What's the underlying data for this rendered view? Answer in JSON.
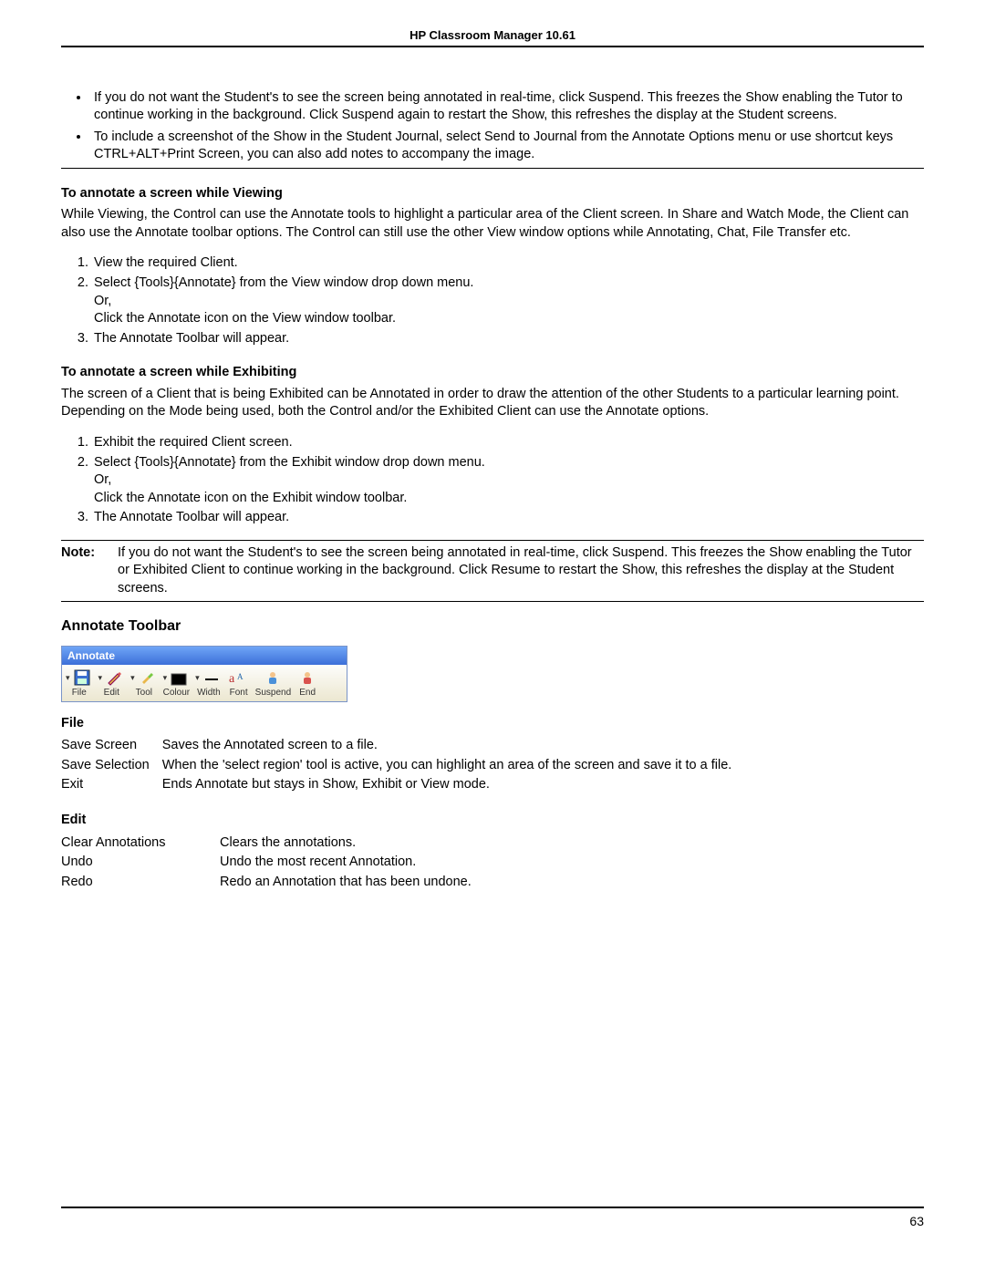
{
  "header": {
    "title": "HP Classroom Manager 10.61"
  },
  "bullets_top": [
    "If you do not want the Student's to see the screen being annotated in real-time, click Suspend. This freezes the Show enabling the Tutor to continue working in the background. Click Suspend again to restart the Show, this refreshes the display at the Student screens.",
    "To include a screenshot of the Show in the Student Journal, select Send to Journal from the Annotate Options menu or use shortcut keys CTRL+ALT+Print Screen, you can also add notes to accompany the image."
  ],
  "viewing": {
    "heading": "To annotate a screen while Viewing",
    "intro": "While Viewing, the Control can use the Annotate tools to highlight a particular area of the Client screen. In Share and Watch Mode, the Client can also use the Annotate toolbar options. The Control can still use the other View window options while Annotating, Chat, File Transfer etc.",
    "steps": [
      "View the required Client.",
      "Select {Tools}{Annotate} from the View window drop down menu.\nOr,\nClick the Annotate icon on the View window toolbar.",
      "The Annotate Toolbar will appear."
    ]
  },
  "exhibiting": {
    "heading": "To annotate a screen while Exhibiting",
    "intro": "The screen of a Client that is being Exhibited can be Annotated in order to draw the attention of the other Students to a particular learning point. Depending on the Mode being used, both the Control and/or the Exhibited Client can use the Annotate options.",
    "steps": [
      "Exhibit the required Client screen.",
      "Select {Tools}{Annotate} from the Exhibit window drop down menu.\nOr,\nClick the Annotate icon on the Exhibit window toolbar.",
      "The Annotate Toolbar will appear."
    ]
  },
  "note": {
    "label": "Note:",
    "text": "If you do not want the Student's to see the screen being annotated in real-time, click Suspend. This freezes the Show enabling the Tutor or Exhibited Client to continue working in the background. Click Resume to restart the Show, this refreshes the display at the Student screens."
  },
  "toolbar_section": {
    "heading": "Annotate Toolbar",
    "window_title": "Annotate",
    "items": [
      "File",
      "Edit",
      "Tool",
      "Colour",
      "Width",
      "Font",
      "Suspend",
      "End"
    ]
  },
  "file_menu": {
    "heading": "File",
    "rows": [
      {
        "term": "Save Screen",
        "desc": "Saves the Annotated screen to a file."
      },
      {
        "term": "Save Selection",
        "desc": "When the 'select region' tool is active, you can highlight an area of the screen and save it to a file."
      },
      {
        "term": "Exit",
        "desc": "Ends Annotate but stays in Show, Exhibit or View mode."
      }
    ]
  },
  "edit_menu": {
    "heading": "Edit",
    "rows": [
      {
        "term": "Clear Annotations",
        "desc": "Clears the annotations."
      },
      {
        "term": "Undo",
        "desc": "Undo the most recent Annotation."
      },
      {
        "term": "Redo",
        "desc": "Redo an Annotation that has been undone."
      }
    ]
  },
  "page_number": "63"
}
